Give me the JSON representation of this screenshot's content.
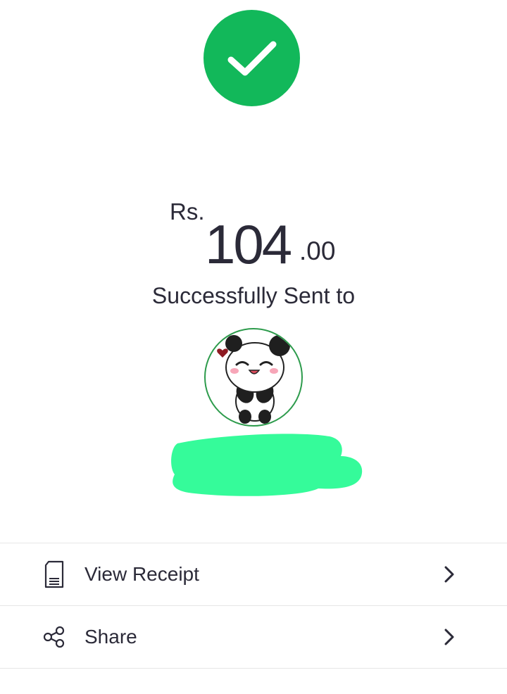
{
  "success": {
    "icon": "checkmark-icon",
    "color": "#12b85a"
  },
  "amount": {
    "currency": "Rs.",
    "whole": "104",
    "decimal": ".00"
  },
  "status": {
    "text": "Successfully Sent to"
  },
  "recipient": {
    "avatar_icon": "panda-avatar",
    "name_redacted": true,
    "redaction_color": "#35fb9a"
  },
  "actions": [
    {
      "icon": "receipt-icon",
      "label": "View Receipt"
    },
    {
      "icon": "share-icon",
      "label": "Share"
    }
  ]
}
